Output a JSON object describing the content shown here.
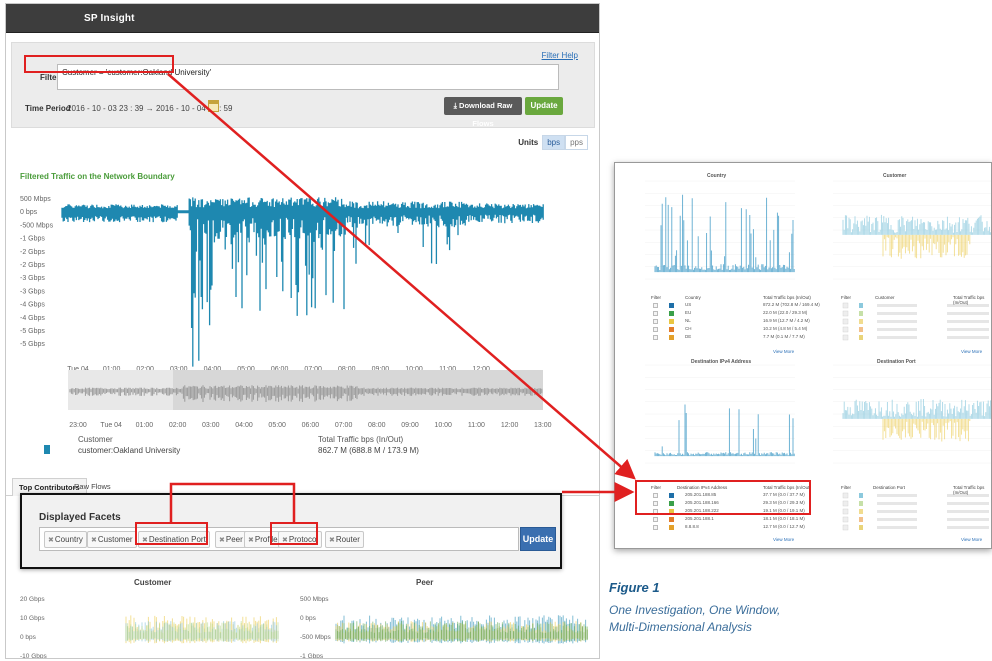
{
  "app": {
    "title": "SP Insight",
    "filter_help": "Filter Help",
    "filter_label": "Filter",
    "filter_value": "Customer = 'customer:Oakland University'",
    "time_period_label": "Time Period",
    "time_period_value": "2016 - 10 - 03  23 : 39   →   2016 - 10 - 04  12 : 59",
    "download_button": "Download Raw Flows",
    "update_button": "Update",
    "units_label": "Units",
    "units": [
      "bps",
      "pps"
    ],
    "units_selected": "bps"
  },
  "main_chart": {
    "title": "Filtered Traffic on the Network Boundary",
    "y_ticks": [
      "500 Mbps",
      "0 bps",
      "-500 Mbps",
      "-1 Gbps",
      "-2 Gbps",
      "-2 Gbps",
      "-3 Gbps",
      "-3 Gbps",
      "-4 Gbps",
      "-4 Gbps",
      "-5 Gbps",
      "-5 Gbps"
    ],
    "x_ticks": [
      "Tue 04",
      "01:00",
      "02:00",
      "03:00",
      "04:00",
      "05:00",
      "06:00",
      "07:00",
      "08:00",
      "09:00",
      "10:00",
      "11:00",
      "12:00"
    ],
    "mini_x_ticks": [
      "23:00",
      "Tue 04",
      "01:00",
      "02:00",
      "03:00",
      "04:00",
      "05:00",
      "06:00",
      "07:00",
      "08:00",
      "09:00",
      "10:00",
      "11:00",
      "12:00",
      "13:00"
    ],
    "series_color": "#1e88b0"
  },
  "legend": {
    "col_customer": "Customer",
    "col_total": "Total Traffic bps (In/Out)",
    "row_customer": "customer:Oakland University",
    "row_total": "862.7 M (688.8 M / 173.9 M)"
  },
  "tabs": [
    "Top Contributors",
    "Raw Flows"
  ],
  "facets": {
    "title": "Displayed Facets",
    "chips": [
      "Country",
      "Customer",
      "Destination Port",
      "Peer",
      "Profile",
      "Protocol",
      "Router"
    ],
    "update_button": "Update"
  },
  "small_charts": {
    "customer": {
      "title": "Customer",
      "y_ticks": [
        "20 Gbps",
        "10 Gbps",
        "0 bps",
        "-10 Gbps"
      ]
    },
    "peer": {
      "title": "Peer",
      "y_ticks": [
        "500 Mbps",
        "0 bps",
        "-500 Mbps",
        "-1 Gbps",
        "-2 Gbps"
      ]
    }
  },
  "thumbnail": {
    "panels": [
      "Country",
      "Customer",
      "Destination IPv4 Address",
      "Destination Port"
    ],
    "filter_col": "Filter",
    "country_col": "Country",
    "customer_col": "Customer",
    "dest_ip_col": "Destination IPv4 Address",
    "dest_port_col": "Destination Port",
    "total_col": "Total Traffic bps (In/Out)",
    "country_rows": [
      {
        "name": "US",
        "val": "872.2 M (702.8 M / 169.4 M)",
        "color": "#1e6fa8"
      },
      {
        "name": "EU",
        "val": "22.0 M (22.0 / 29.3 M)",
        "color": "#3aa04a"
      },
      {
        "name": "NL",
        "val": "16.9 M (12.7 M / 4.2 M)",
        "color": "#e9c642"
      },
      {
        "name": "CH",
        "val": "10.2 M (4.8 M / 5.4 M)",
        "color": "#e37c2a"
      },
      {
        "name": "DE",
        "val": "7.7 M (0.1 M / 7.7 M)",
        "color": "#e3a02a"
      }
    ],
    "ip_rows": [
      {
        "name": "205.201.188.85",
        "val": "37.7 M (0.0 / 37.7 M)",
        "color": "#1e6fa8"
      },
      {
        "name": "205.201.188.166",
        "val": "29.3 M (0.0 / 29.3 M)",
        "color": "#3aa04a"
      },
      {
        "name": "205.201.188.222",
        "val": "19.1 M (0.0 / 19.1 M)",
        "color": "#e9c642"
      },
      {
        "name": "205.201.188.1",
        "val": "18.1 M (0.0 / 18.1 M)",
        "color": "#e37c2a"
      },
      {
        "name": "8.8.8.8",
        "val": "12.7 M (0.0 / 12.7 M)",
        "color": "#e3a02a"
      }
    ],
    "view_more": "View More"
  },
  "figure": {
    "label": "Figure 1",
    "caption_line1": "One Investigation, One Window,",
    "caption_line2": "Multi-Dimensional Analysis"
  },
  "colors": {
    "highlight": "#e02020",
    "traffic_blue": "#1e88b0",
    "brand_green": "#6aa83e",
    "button_blue": "#3a6fb0"
  }
}
